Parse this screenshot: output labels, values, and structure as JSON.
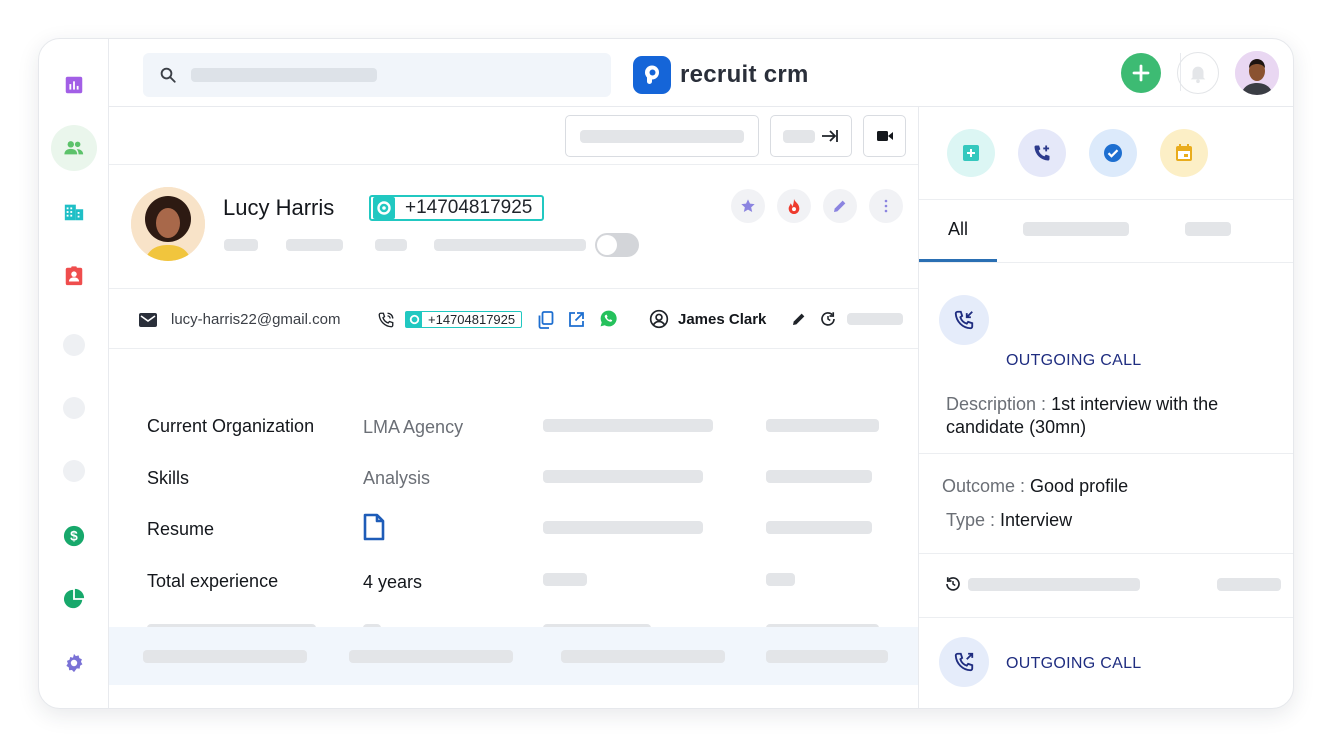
{
  "brand": {
    "name": "recruit crm",
    "logo_color": "#1565d8"
  },
  "colors": {
    "accent_teal": "#21c8c1",
    "add_green": "#3dbb73",
    "call_blue": "#1f2d80",
    "tab_underline": "#2a6fb3"
  },
  "sidebar": {
    "items": [
      {
        "icon": "bar-chart-icon",
        "color": "#a25fe6"
      },
      {
        "icon": "people-icon",
        "color": "#5cc26a",
        "active": true
      },
      {
        "icon": "building-icon",
        "color": "#1fbfc6"
      },
      {
        "icon": "contact-card-icon",
        "color": "#ef4d4d"
      },
      {
        "icon": "dollar-icon",
        "color": "#17a86b"
      },
      {
        "icon": "pie-chart-icon",
        "color": "#17a86b"
      },
      {
        "icon": "settings-icon",
        "color": "#7a72d6"
      }
    ]
  },
  "header": {
    "search_icon": "search-icon",
    "add_icon": "plus-icon",
    "bell_icon": "bell-icon",
    "user_avatar": "user-avatar"
  },
  "candidate": {
    "name": "Lucy Harris",
    "phone": "+14704817925",
    "email": "lucy-harris22@gmail.com",
    "phone_small": "+14704817925",
    "owner": "James Clark"
  },
  "details": [
    {
      "label": "Current Organization",
      "value": "LMA Agency"
    },
    {
      "label": "Skills",
      "value": "Analysis"
    },
    {
      "label": "Resume",
      "value_icon": "document-icon"
    },
    {
      "label": "Total experience",
      "value": "4 years"
    }
  ],
  "activity": {
    "tabs": [
      {
        "label": "All",
        "active": true
      }
    ],
    "items": [
      {
        "title": "OUTGOING CALL",
        "description_label": "Description :",
        "description": "1st interview with the candidate (30mn)",
        "outcome_label": "Outcome :",
        "outcome": "Good profile",
        "type_label": "Type :",
        "type": "Interview"
      },
      {
        "title": "OUTGOING CALL"
      }
    ]
  }
}
